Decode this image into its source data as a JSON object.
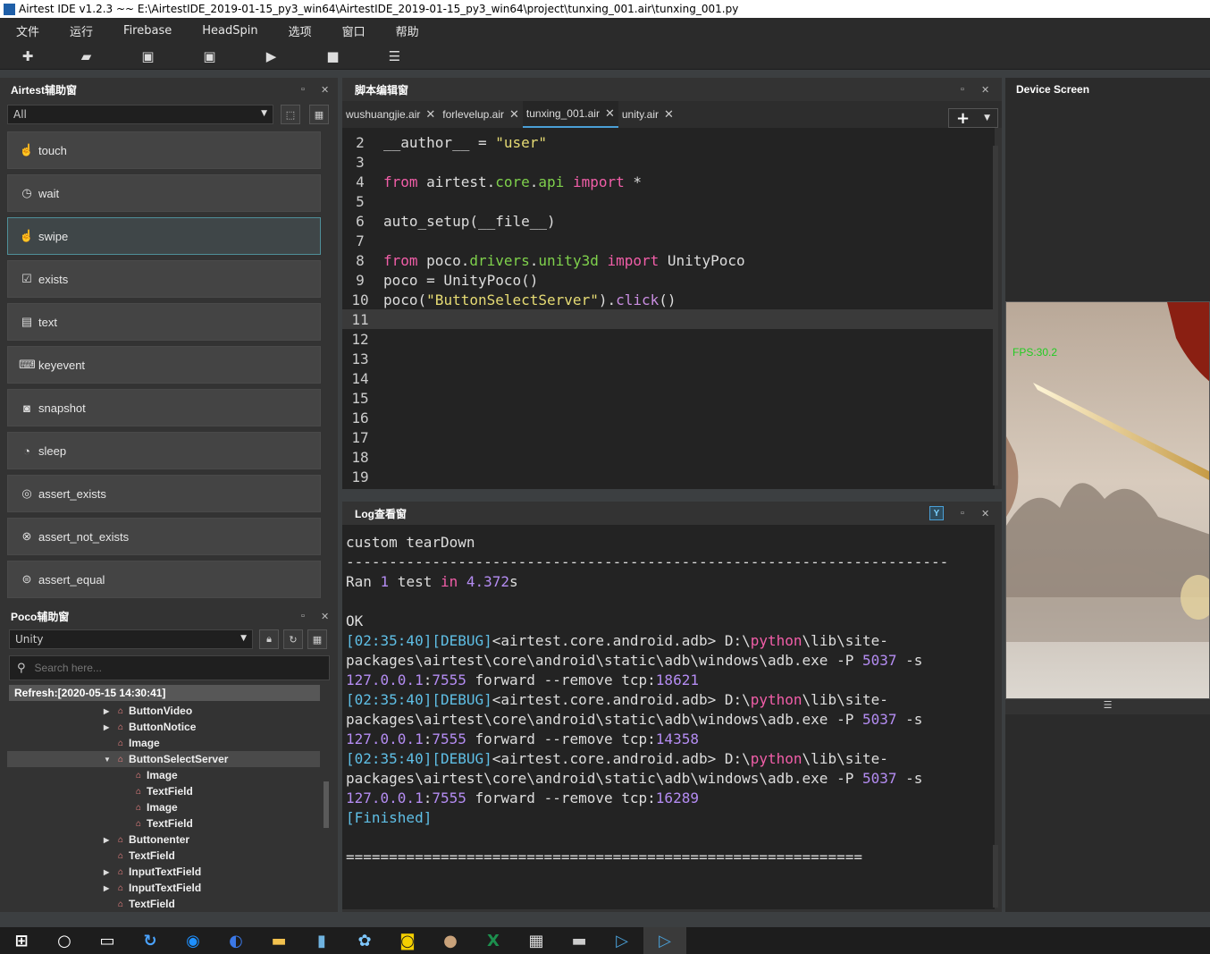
{
  "window": {
    "title": "Airtest IDE v1.2.3 ~~ E:\\AirtestIDE_2019-01-15_py3_win64\\AirtestIDE_2019-01-15_py3_win64\\project\\tunxing_001.air\\tunxing_001.py"
  },
  "menu": [
    "文件",
    "运行",
    "Firebase",
    "HeadSpin",
    "选项",
    "窗口",
    "帮助"
  ],
  "toolbar": [
    {
      "icon": "new-icon",
      "glyph": "✚"
    },
    {
      "icon": "open-folder-icon",
      "glyph": "▰"
    },
    {
      "icon": "save-icon",
      "glyph": "▣"
    },
    {
      "icon": "save-as-icon",
      "glyph": "▣"
    },
    {
      "icon": "run-icon",
      "glyph": "▶"
    },
    {
      "icon": "stop-icon",
      "glyph": "■"
    },
    {
      "icon": "report-icon",
      "glyph": "☰"
    }
  ],
  "airtest_panel": {
    "title": "Airtest辅助窗",
    "filter": "All",
    "buttons": [
      {
        "label": "touch",
        "icon": "touch-icon",
        "glyph": "☝"
      },
      {
        "label": "wait",
        "icon": "clock-icon",
        "glyph": "◷"
      },
      {
        "label": "swipe",
        "icon": "swipe-icon",
        "glyph": "☝"
      },
      {
        "label": "exists",
        "icon": "check-circle-icon",
        "glyph": "☑"
      },
      {
        "label": "text",
        "icon": "text-icon",
        "glyph": "▤"
      },
      {
        "label": "keyevent",
        "icon": "keyboard-icon",
        "glyph": "⌨"
      },
      {
        "label": "snapshot",
        "icon": "camera-icon",
        "glyph": "◙"
      },
      {
        "label": "sleep",
        "icon": "sleep-icon",
        "glyph": "◔"
      },
      {
        "label": "assert_exists",
        "icon": "assert-exists-icon",
        "glyph": "◎"
      },
      {
        "label": "assert_not_exists",
        "icon": "assert-not-exists-icon",
        "glyph": "⊗"
      },
      {
        "label": "assert_equal",
        "icon": "assert-equal-icon",
        "glyph": "⊜"
      }
    ]
  },
  "poco_panel": {
    "title": "Poco辅助窗",
    "mode": "Unity",
    "search_placeholder": "Search here...",
    "refresh": "Refresh:[2020-05-15 14:30:41]",
    "tree": [
      {
        "label": "ButtonVideo",
        "level": 1,
        "expander": "▶"
      },
      {
        "label": "ButtonNotice",
        "level": 1,
        "expander": "▶"
      },
      {
        "label": "Image",
        "level": 1,
        "expander": ""
      },
      {
        "label": "ButtonSelectServer",
        "level": 1,
        "expander": "▼",
        "selected": true
      },
      {
        "label": "Image",
        "level": 2,
        "expander": ""
      },
      {
        "label": "TextField",
        "level": 2,
        "expander": ""
      },
      {
        "label": "Image",
        "level": 2,
        "expander": ""
      },
      {
        "label": "TextField",
        "level": 2,
        "expander": ""
      },
      {
        "label": "Buttonenter",
        "level": 1,
        "expander": "▶"
      },
      {
        "label": "TextField",
        "level": 1,
        "expander": ""
      },
      {
        "label": "InputTextField",
        "level": 1,
        "expander": "▶"
      },
      {
        "label": "InputTextField",
        "level": 1,
        "expander": "▶"
      },
      {
        "label": "TextField",
        "level": 1,
        "expander": ""
      }
    ]
  },
  "editor": {
    "title": "脚本编辑窗",
    "tabs": [
      {
        "label": "wushuangjie.air",
        "active": false
      },
      {
        "label": "forlevelup.air",
        "active": false
      },
      {
        "label": "tunxing_001.air",
        "active": true
      },
      {
        "label": "unity.air",
        "active": false
      }
    ],
    "lines": [
      {
        "n": "2",
        "segs": [
          [
            "__author__ = ",
            ""
          ],
          [
            "\"user\"",
            "str"
          ]
        ]
      },
      {
        "n": "3",
        "segs": []
      },
      {
        "n": "4",
        "segs": [
          [
            "from",
            "kw"
          ],
          [
            " airtest.",
            ""
          ],
          [
            "core",
            "mod"
          ],
          [
            ".",
            ""
          ],
          [
            "api",
            "mod"
          ],
          [
            " ",
            ""
          ],
          [
            "import",
            "kw"
          ],
          [
            " *",
            ""
          ]
        ]
      },
      {
        "n": "5",
        "segs": []
      },
      {
        "n": "6",
        "segs": [
          [
            "auto_setup(__file__)",
            ""
          ]
        ]
      },
      {
        "n": "7",
        "segs": []
      },
      {
        "n": "8",
        "segs": [
          [
            "from",
            "kw"
          ],
          [
            " poco.",
            ""
          ],
          [
            "drivers",
            "mod"
          ],
          [
            ".",
            ""
          ],
          [
            "unity3d",
            "mod"
          ],
          [
            " ",
            ""
          ],
          [
            "import",
            "kw"
          ],
          [
            " UnityPoco",
            ""
          ]
        ]
      },
      {
        "n": "9",
        "segs": [
          [
            "poco = UnityPoco()",
            ""
          ]
        ]
      },
      {
        "n": "10",
        "segs": [
          [
            "poco(",
            ""
          ],
          [
            "\"ButtonSelectServer\"",
            "str"
          ],
          [
            ").",
            ""
          ],
          [
            "click",
            "fn"
          ],
          [
            "()",
            ""
          ]
        ]
      },
      {
        "n": "11",
        "segs": [],
        "current": true
      },
      {
        "n": "12",
        "segs": []
      },
      {
        "n": "13",
        "segs": []
      },
      {
        "n": "14",
        "segs": []
      },
      {
        "n": "15",
        "segs": []
      },
      {
        "n": "16",
        "segs": []
      },
      {
        "n": "17",
        "segs": []
      },
      {
        "n": "18",
        "segs": []
      },
      {
        "n": "19",
        "segs": []
      }
    ]
  },
  "log": {
    "title": "Log查看窗",
    "lines": [
      [
        [
          "custom tearDown",
          ""
        ]
      ],
      [
        [
          "----------------------------------------------------------------------",
          ""
        ]
      ],
      [
        [
          "Ran ",
          ""
        ],
        [
          "1",
          "lv"
        ],
        [
          " test ",
          ""
        ],
        [
          "in",
          "lp"
        ],
        [
          " ",
          ""
        ],
        [
          "4.372",
          "lv"
        ],
        [
          "s",
          ""
        ]
      ],
      [],
      [
        [
          "OK",
          ""
        ]
      ],
      [
        [
          "[02:35:40][DEBUG]",
          "lb"
        ],
        [
          "<airtest.core.android.adb> D:\\",
          ""
        ],
        [
          "python",
          "lp"
        ],
        [
          "\\lib\\site-",
          ""
        ]
      ],
      [
        [
          "packages\\airtest\\core\\android\\static\\adb\\windows\\adb.exe -P ",
          ""
        ],
        [
          "5037",
          "lv"
        ],
        [
          " -s",
          ""
        ]
      ],
      [
        [
          "127.0.0.1",
          "lv"
        ],
        [
          ":",
          ""
        ],
        [
          "7555",
          "lv"
        ],
        [
          " forward --remove tcp:",
          ""
        ],
        [
          "18621",
          "lv"
        ]
      ],
      [
        [
          "[02:35:40][DEBUG]",
          "lb"
        ],
        [
          "<airtest.core.android.adb> D:\\",
          ""
        ],
        [
          "python",
          "lp"
        ],
        [
          "\\lib\\site-",
          ""
        ]
      ],
      [
        [
          "packages\\airtest\\core\\android\\static\\adb\\windows\\adb.exe -P ",
          ""
        ],
        [
          "5037",
          "lv"
        ],
        [
          " -s",
          ""
        ]
      ],
      [
        [
          "127.0.0.1",
          "lv"
        ],
        [
          ":",
          ""
        ],
        [
          "7555",
          "lv"
        ],
        [
          " forward --remove tcp:",
          ""
        ],
        [
          "14358",
          "lv"
        ]
      ],
      [
        [
          "[02:35:40][DEBUG]",
          "lb"
        ],
        [
          "<airtest.core.android.adb> D:\\",
          ""
        ],
        [
          "python",
          "lp"
        ],
        [
          "\\lib\\site-",
          ""
        ]
      ],
      [
        [
          "packages\\airtest\\core\\android\\static\\adb\\windows\\adb.exe -P ",
          ""
        ],
        [
          "5037",
          "lv"
        ],
        [
          " -s",
          ""
        ]
      ],
      [
        [
          "127.0.0.1",
          "lv"
        ],
        [
          ":",
          ""
        ],
        [
          "7555",
          "lv"
        ],
        [
          " forward --remove tcp:",
          ""
        ],
        [
          "16289",
          "lv"
        ]
      ],
      [
        [
          "[Finished]",
          "lb"
        ]
      ],
      [],
      [
        [
          "============================================================",
          ""
        ]
      ]
    ]
  },
  "device": {
    "title": "Device Screen",
    "fps": "FPS:30.2"
  },
  "taskbar": [
    {
      "icon": "windows-start-icon"
    },
    {
      "icon": "search-circle-icon"
    },
    {
      "icon": "task-view-icon"
    },
    {
      "icon": "refresh-app-icon"
    },
    {
      "icon": "blue-app-icon"
    },
    {
      "icon": "chrome-icon"
    },
    {
      "icon": "file-explorer-icon"
    },
    {
      "icon": "notepad-icon"
    },
    {
      "icon": "network-icon"
    },
    {
      "icon": "yellow-app-icon"
    },
    {
      "icon": "avatar-app-icon"
    },
    {
      "icon": "excel-icon"
    },
    {
      "icon": "calculator-icon"
    },
    {
      "icon": "terminal-icon"
    },
    {
      "icon": "airtest-icon"
    },
    {
      "icon": "airtest-active-icon",
      "active": true
    }
  ],
  "colors": {
    "accent": "#4a9fd6",
    "keyword": "#f15ea8",
    "string": "#e6db74",
    "module": "#7fd14c",
    "fps": "#22cc22"
  }
}
